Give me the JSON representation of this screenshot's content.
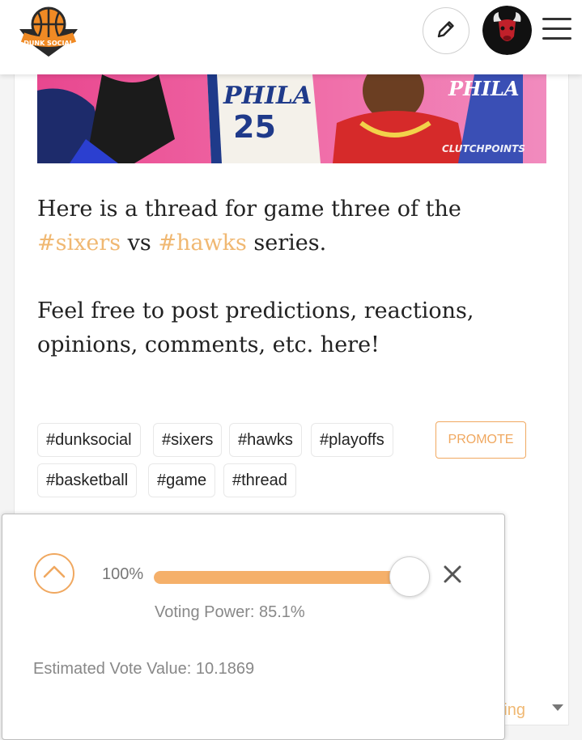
{
  "header": {
    "logo_text": "DUNK SOCIAL",
    "icons": {
      "edit": "pencil-icon",
      "avatar": "bull-avatar",
      "menu": "hamburger-menu-icon"
    }
  },
  "banner": {
    "jersey_left": "PHILA",
    "jersey_number": "25",
    "jersey_right": "PHILA",
    "watermark": "CLUTCHPOINTS"
  },
  "post": {
    "line1_pre": "Here is a thread for game three of the ",
    "tag_sixers": "#sixers",
    "line1_mid": " vs ",
    "tag_hawks": "#hawks",
    "line1_post": " series.",
    "paragraph2": "Feel free to post predictions, reactions, opinions, comments, etc. here!"
  },
  "tags": [
    "#dunksocial",
    "#sixers",
    "#hawks",
    "#playoffs",
    "#basketball",
    "#game",
    "#thread"
  ],
  "promote_label": "PROMOTE",
  "sort": {
    "label": "nding"
  },
  "vote_panel": {
    "percent_label": "100%",
    "weight_fraction": 1.0,
    "voting_power": "Voting Power: 85.1%",
    "estimated_value": "Estimated Vote Value: 10.1869"
  },
  "colors": {
    "accent": "#f0a860",
    "tag_text": "#f0b872",
    "slider_fill": "#f5b06a"
  }
}
